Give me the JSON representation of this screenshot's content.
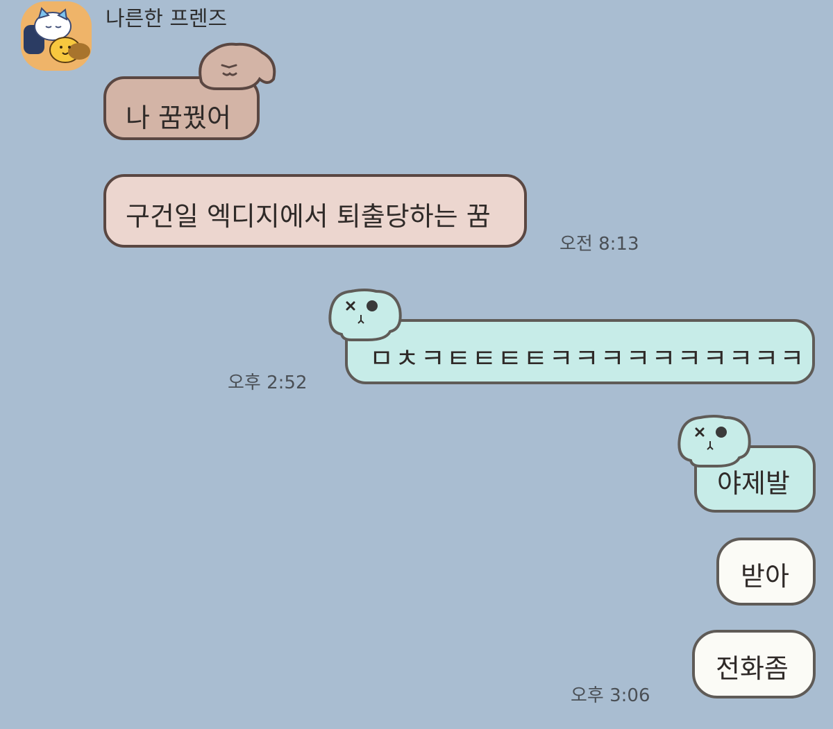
{
  "chat": {
    "sender_name": "나른한 프렌즈"
  },
  "messages": [
    {
      "text": "나 꿈꿨어",
      "direction": "received"
    },
    {
      "text": "구건일 엑디지에서 퇴출당하는 꿈",
      "direction": "received",
      "time": "오전 8:13"
    },
    {
      "text": "ㅁㅊㅋㅌㅌㅌㅌㅋㅋㅋㅋㅋㅋㅋㅋㅋㅋ",
      "direction": "sent",
      "time": "오후 2:52"
    },
    {
      "text": "야제발",
      "direction": "sent"
    },
    {
      "text": "받아",
      "direction": "sent"
    },
    {
      "text": "전화좀",
      "direction": "sent",
      "time": "오후 3:06"
    }
  ],
  "colors": {
    "background": "#a9bdd1",
    "received_bubble_brown": "#d3b4a6",
    "received_bubble_beige": "#ecd6cf",
    "sent_bubble_mint": "#c7ece8",
    "sent_bubble_white": "#fbfbf6"
  },
  "icons": {
    "avatar": "sleeping-cat-avatar",
    "brown_bubble_decoration": "puppy-ears-icon",
    "mint_bubble_decoration": "bunny-ears-icon"
  }
}
